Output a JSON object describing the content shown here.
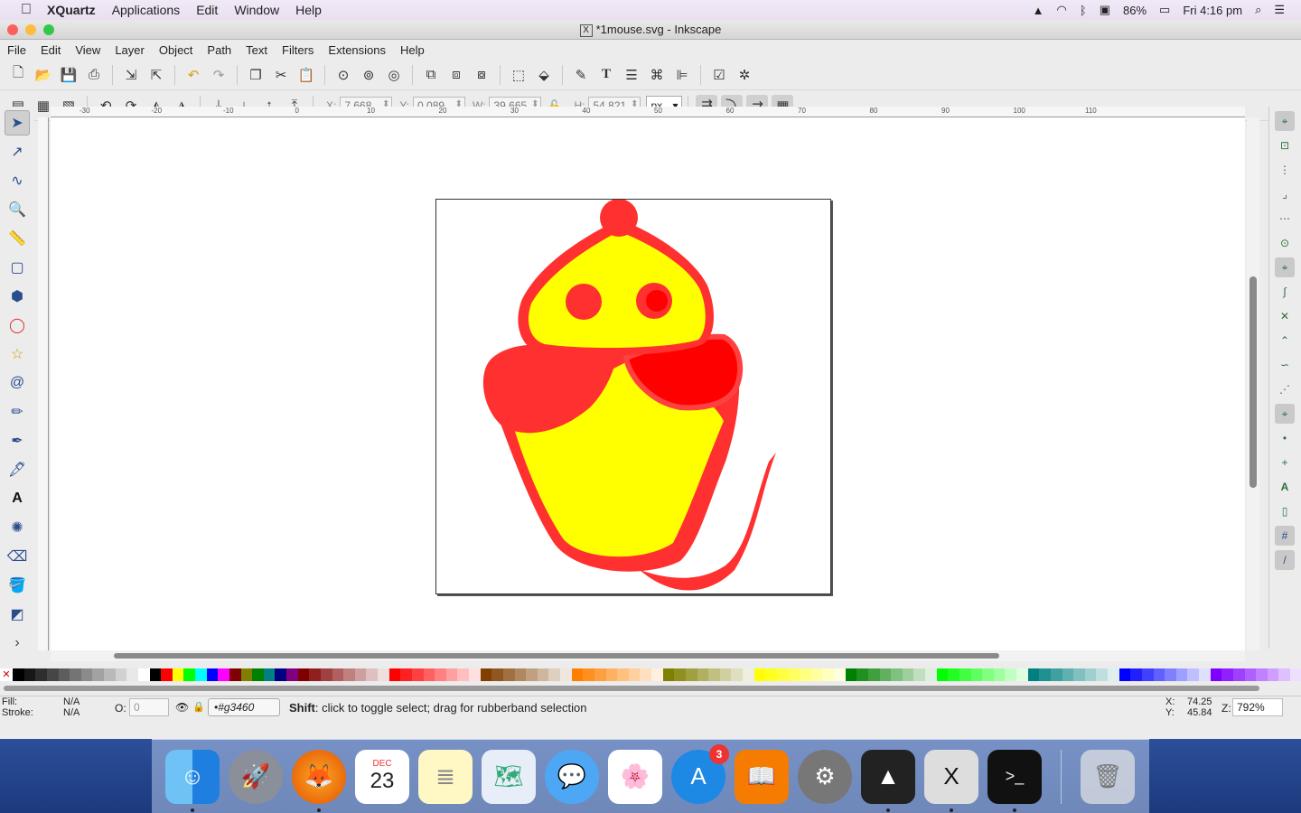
{
  "menubar": {
    "app_name": "XQuartz",
    "items": [
      "Applications",
      "Edit",
      "Window",
      "Help"
    ],
    "battery": "86%",
    "clock": "Fri 4:16 pm"
  },
  "window": {
    "title": "*1mouse.svg - Inkscape"
  },
  "app_menu": [
    "File",
    "Edit",
    "View",
    "Layer",
    "Object",
    "Path",
    "Text",
    "Filters",
    "Extensions",
    "Help"
  ],
  "controls": {
    "x_label": "X:",
    "x_value": "7.668",
    "y_label": "Y:",
    "y_value": "0.089",
    "w_label": "W:",
    "w_value": "39.665",
    "h_label": "H:",
    "h_value": "54.821",
    "unit": "px"
  },
  "ruler_labels": [
    "-30",
    "-20",
    "-10",
    "0",
    "10",
    "20",
    "30",
    "40",
    "50",
    "60",
    "70",
    "80",
    "90",
    "100",
    "110"
  ],
  "status": {
    "fill_label": "Fill:",
    "fill_value": "N/A",
    "stroke_label": "Stroke:",
    "stroke_value": "N/A",
    "opacity_label": "O:",
    "opacity_value": "0",
    "layer": "•#g3460",
    "message_key": "Shift",
    "message_rest": ": click to toggle select; drag for rubberband selection",
    "x_label": "X:",
    "x_value": "74.25",
    "y_label": "Y:",
    "y_value": "45.84",
    "z_label": "Z:",
    "zoom": "792%"
  },
  "dock": {
    "calendar_month": "DEC",
    "calendar_day": "23",
    "appstore_badge": "3"
  },
  "colors": {
    "drawing_red": "#ff3030",
    "drawing_yellow": "#ffff00",
    "drawing_ear": "#ff0000"
  }
}
